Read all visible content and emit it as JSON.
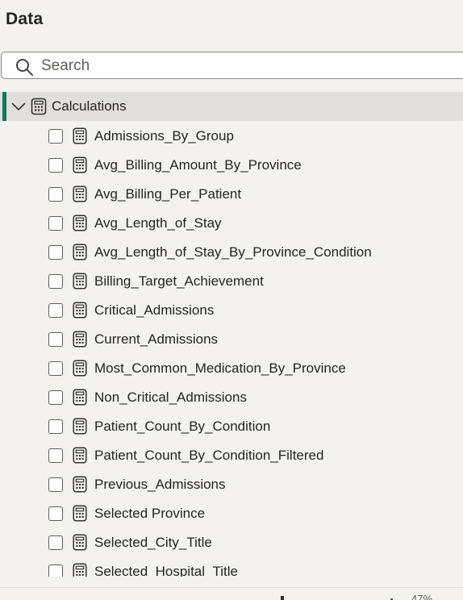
{
  "pane": {
    "title": "Data"
  },
  "search": {
    "placeholder": "Search",
    "value": ""
  },
  "group": {
    "label": "Calculations",
    "expanded": true,
    "icon": "calculator-icon"
  },
  "items": [
    {
      "label": "Admissions_By_Group",
      "checked": false
    },
    {
      "label": "Avg_Billing_Amount_By_Province",
      "checked": false
    },
    {
      "label": "Avg_Billing_Per_Patient",
      "checked": false
    },
    {
      "label": "Avg_Length_of_Stay",
      "checked": false
    },
    {
      "label": "Avg_Length_of_Stay_By_Province_Condition",
      "checked": false
    },
    {
      "label": "Billing_Target_Achievement",
      "checked": false
    },
    {
      "label": "Critical_Admissions",
      "checked": false
    },
    {
      "label": "Current_Admissions",
      "checked": false
    },
    {
      "label": "Most_Common_Medication_By_Province",
      "checked": false
    },
    {
      "label": "Non_Critical_Admissions",
      "checked": false
    },
    {
      "label": "Patient_Count_By_Condition",
      "checked": false
    },
    {
      "label": "Patient_Count_By_Condition_Filtered",
      "checked": false
    },
    {
      "label": "Previous_Admissions",
      "checked": false
    },
    {
      "label": "Selected Province",
      "checked": false
    },
    {
      "label": "Selected_City_Title",
      "checked": false
    },
    {
      "label": "Selected_Hospital_Title",
      "checked": false
    }
  ],
  "status": {
    "zoom": "47%"
  },
  "colors": {
    "accent": "#117865",
    "background": "#f3f2f1",
    "selected_row": "#e1dfdd"
  }
}
